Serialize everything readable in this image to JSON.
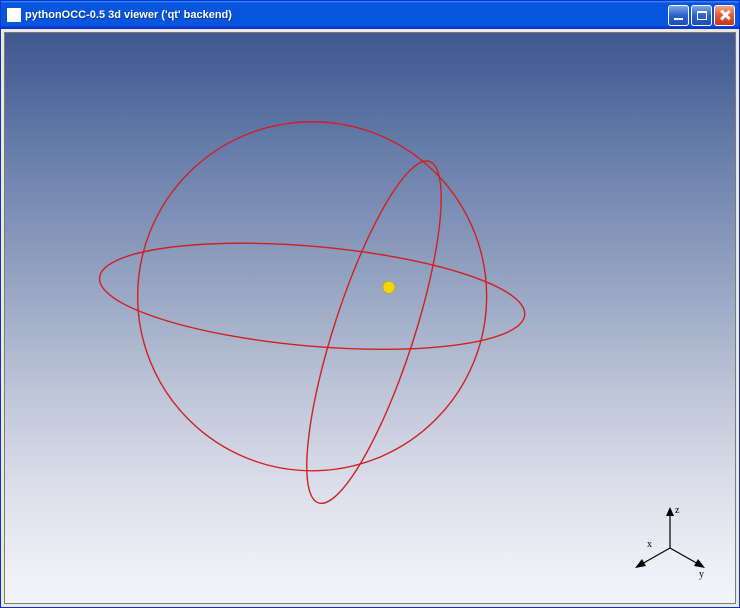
{
  "window": {
    "title": "pythonOCC-0.5 3d viewer ('qt' backend)"
  },
  "axes": {
    "x": "x",
    "y": "y",
    "z": "z"
  }
}
